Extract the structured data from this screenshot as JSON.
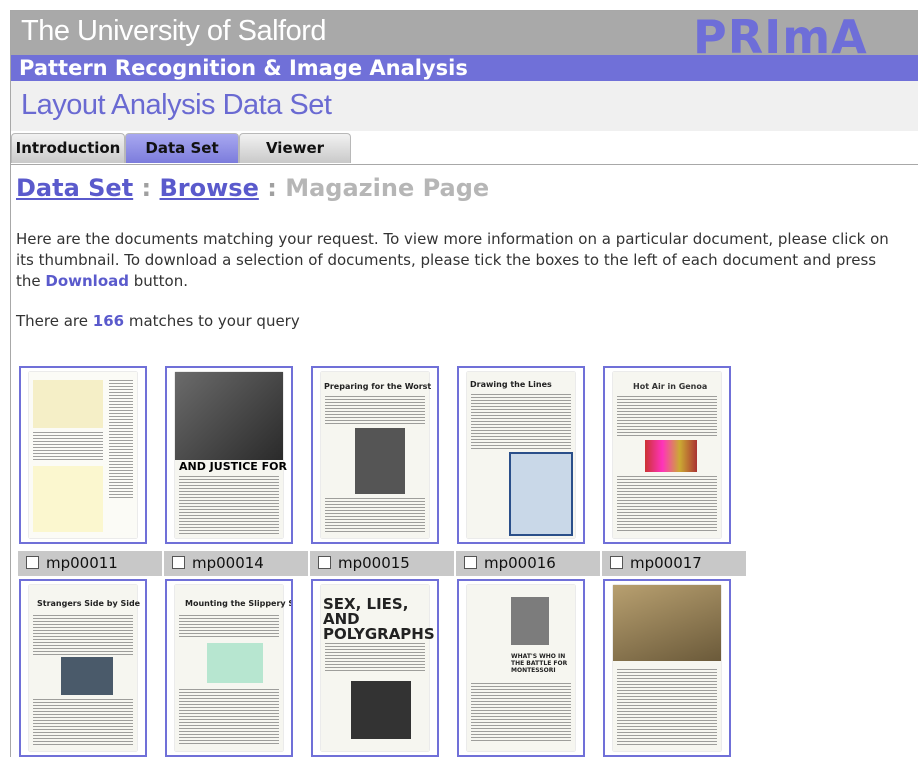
{
  "header": {
    "university": "The University of Salford",
    "logo_text": "PRImA",
    "subtitle": "Pattern Recognition & Image Analysis",
    "section_title": "Layout Analysis Data Set"
  },
  "tabs": [
    {
      "label": "Introduction",
      "active": false
    },
    {
      "label": "Data Set",
      "active": true
    },
    {
      "label": "Viewer",
      "active": false
    }
  ],
  "breadcrumb": {
    "link1": "Data Set",
    "sep": ":",
    "link2": "Browse",
    "current": "Magazine Page"
  },
  "intro": {
    "line1": "Here are the documents matching your request. To view more information on a particular document, please click on",
    "line2": "its thumbnail. To download a selection of documents, please tick the boxes to the left of each document and press",
    "line3_pre": "the ",
    "line3_link": "Download",
    "line3_post": " button."
  },
  "matches": {
    "pre": "There are ",
    "count": "166",
    "post": " matches to your query"
  },
  "documents": [
    {
      "id": "mp00011",
      "heading": ""
    },
    {
      "id": "mp00014",
      "heading": "AND JUSTICE FOR ..."
    },
    {
      "id": "mp00015",
      "heading": "Preparing for the Worst"
    },
    {
      "id": "mp00016",
      "heading": "Drawing the Lines"
    },
    {
      "id": "mp00017",
      "heading": "Hot Air in Genoa"
    },
    {
      "id": "",
      "heading": "Strangers Side by Side"
    },
    {
      "id": "",
      "heading": "Mounting the Slippery Slope"
    },
    {
      "id": "",
      "heading": "SEX, LIES, AND POLYGRAPHS"
    },
    {
      "id": "",
      "heading": "WHAT'S WHO IN THE BATTLE FOR MONTESSORI"
    },
    {
      "id": "",
      "heading": ""
    }
  ],
  "colors": {
    "accent": "#7070d8",
    "banner": "#a9a9a9",
    "link": "#5a5acc"
  }
}
